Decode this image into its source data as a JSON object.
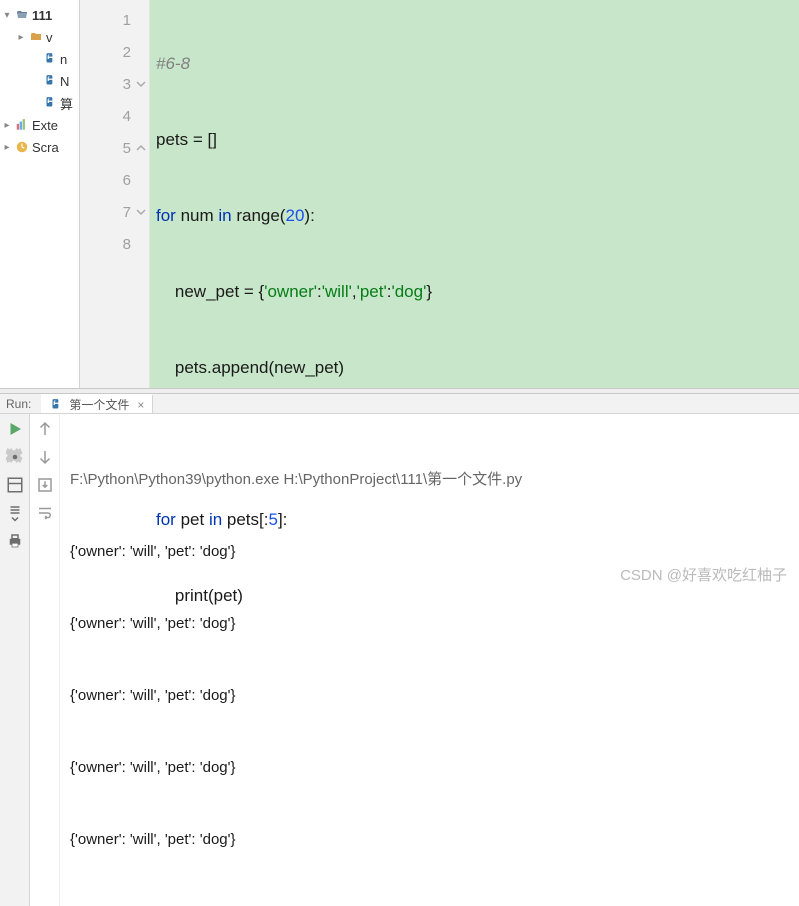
{
  "sidebar": {
    "project": "111",
    "folder1": "v",
    "file1": "n",
    "file2": "N",
    "file3": "算",
    "external": "Exte",
    "scratches": "Scra"
  },
  "gutter": [
    "1",
    "2",
    "3",
    "4",
    "5",
    "6",
    "7",
    "8"
  ],
  "code": {
    "l1_comment": "#6-8",
    "l2": "pets = []",
    "l3_for": "for",
    "l3_mid": " num ",
    "l3_in": "in",
    "l3_range": " range(",
    "l3_num": "20",
    "l3_end": "):",
    "l4_a": "    new_pet = {",
    "l4_s1": "'owner'",
    "l4_c1": ":",
    "l4_s2": "'will'",
    "l4_c2": ",",
    "l4_s3": "'pet'",
    "l4_c3": ":",
    "l4_s4": "'dog'",
    "l4_e": "}",
    "l5": "    pets.append(new_pet)",
    "l7_for": "for",
    "l7_mid": " pet ",
    "l7_in": "in",
    "l7_rest": " pets[:",
    "l7_num": "5",
    "l7_end": "]:",
    "l8": "    print(pet)"
  },
  "run": {
    "label": "Run:",
    "tab": "第一个文件",
    "cmd": "F:\\Python\\Python39\\python.exe H:\\PythonProject\\111\\第一个文件.py",
    "out": [
      "{'owner': 'will', 'pet': 'dog'}",
      "{'owner': 'will', 'pet': 'dog'}",
      "{'owner': 'will', 'pet': 'dog'}",
      "{'owner': 'will', 'pet': 'dog'}",
      "{'owner': 'will', 'pet': 'dog'}"
    ]
  },
  "watermark": "CSDN @好喜欢吃红柚子"
}
